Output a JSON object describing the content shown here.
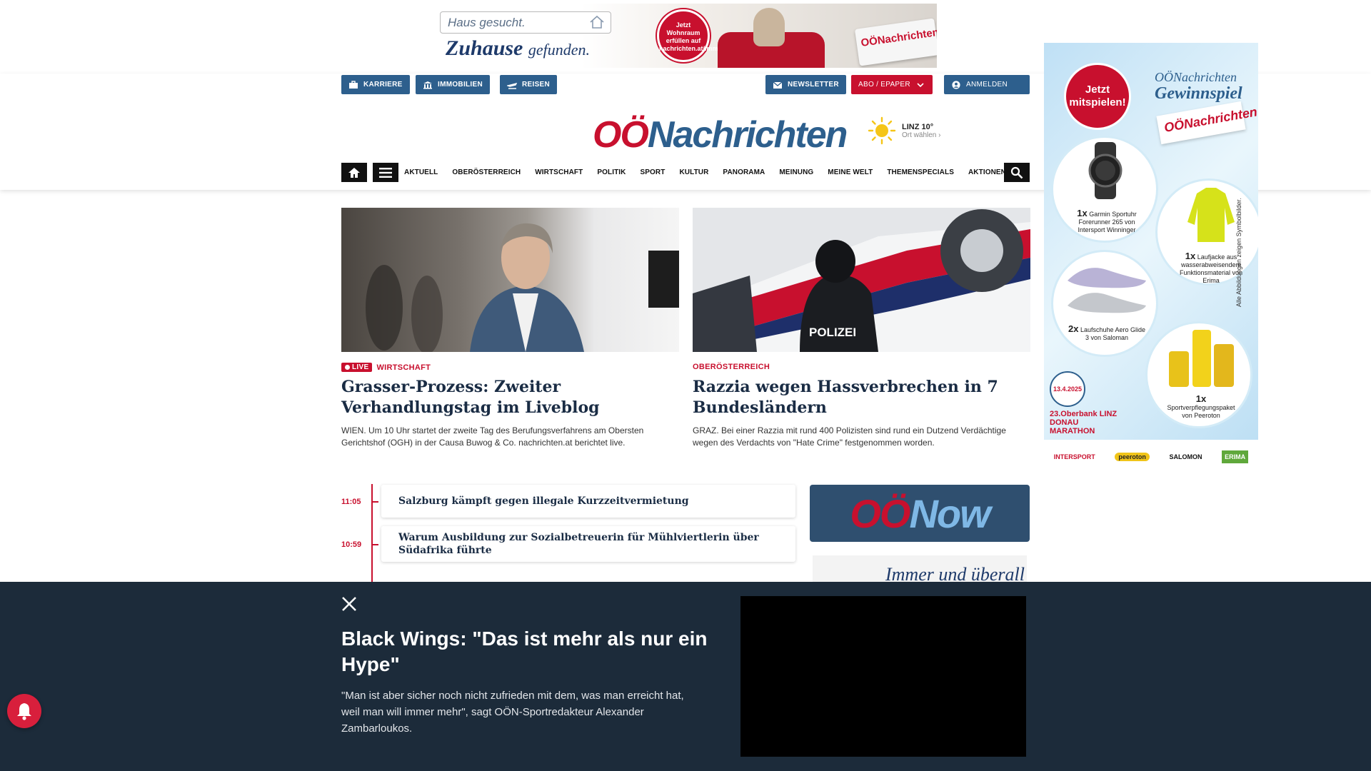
{
  "top_ad": {
    "search_text": "Haus gesucht.",
    "slogan_main": "Zuhause",
    "slogan_sub": "gefunden.",
    "badge_text": "Jetzt Wohnraum erfüllen auf nachrichten.at/immobilien",
    "paper_text": "OÖNachrichten"
  },
  "header": {
    "top_buttons": {
      "karriere": "KARRIERE",
      "immobilien": "IMMOBILIEN",
      "reisen": "REISEN",
      "newsletter": "NEWSLETTER",
      "abo": "ABO / EPAPER",
      "anmelden": "ANMELDEN"
    },
    "logo": {
      "part1": "OÖ",
      "part2": "Nachrichten"
    },
    "weather": {
      "city": "LINZ 10°",
      "sub": "Ort wählen"
    },
    "nav": [
      "AKTUELL",
      "OBERÖSTERREICH",
      "WIRTSCHAFT",
      "POLITIK",
      "SPORT",
      "KULTUR",
      "PANORAMA",
      "MEINUNG",
      "MEINE WELT",
      "THEMENSPECIALS",
      "AKTIONEN"
    ]
  },
  "articles": [
    {
      "live": "LIVE",
      "kicker": "WIRTSCHAFT",
      "title": "Grasser-Prozess: Zweiter Verhandlungstag im Liveblog",
      "teaser": "WIEN. Um 10 Uhr startet der zweite Tag des Berufungsverfahrens am Obersten Gerichtshof (OGH) in der Causa Buwog & Co. nachrichten.at berichtet live."
    },
    {
      "kicker": "OBERÖSTERREICH",
      "title": "Razzia wegen Hassverbrechen in 7 Bundesländern",
      "teaser": "GRAZ. Bei einer Razzia mit rund 400 Polizisten sind rund ein Dutzend Verdächtige wegen des Verdachts von \"Hate Crime\" festgenommen worden.",
      "image_text": "POLIZEI"
    }
  ],
  "ticker": [
    {
      "time": "11:05",
      "title": "Salzburg kämpft gegen illegale Kurzzeitvermietung"
    },
    {
      "time": "10:59",
      "title": "Warum Ausbildung zur Sozialbetreuerin für Mühlviertlerin über Südafrika führte"
    }
  ],
  "oonow": {
    "part1": "OÖ",
    "part2": "Now"
  },
  "immer_ad": "Immer und überall",
  "side_ad": {
    "badge": "Jetzt mitspielen!",
    "title": "OÖNachrichten",
    "title2": "Gewinnspiel",
    "paper": "OÖNachrichten",
    "prizes": [
      {
        "count": "1x",
        "text": "Garmin Sportuhr Forerunner 265 von Intersport Winninger"
      },
      {
        "count": "1x",
        "text": "Laufjacke aus wasserabweisendem Funktionsmaterial von Erima"
      },
      {
        "count": "2x",
        "text": "Laufschuhe Aero Glide 3 von Saloman"
      },
      {
        "count": "1x",
        "text": "Sportverpflegungspaket von Peeroton"
      }
    ],
    "disclaimer": "Alle Abbildungen zeigen Symbolbilder.",
    "race_date": "13.4.2025",
    "race_name": "23.Oberbank LINZ DONAU MARATHON",
    "sponsors": [
      "INTERSPORT",
      "peeroton",
      "SALOMON",
      "ERIMA"
    ]
  },
  "sticky": {
    "title": "Black Wings: \"Das ist mehr als nur ein Hype\"",
    "teaser": "\"Man ist aber sicher noch nicht zufrieden mit dem, was man erreicht hat, weil man will immer mehr\", sagt OÖN-Sportredakteur Alexander Zambarloukos."
  },
  "colors": {
    "brand_red": "#c8102e",
    "brand_blue": "#2d5f8d",
    "sticky_bg": "#1c2b3a"
  }
}
